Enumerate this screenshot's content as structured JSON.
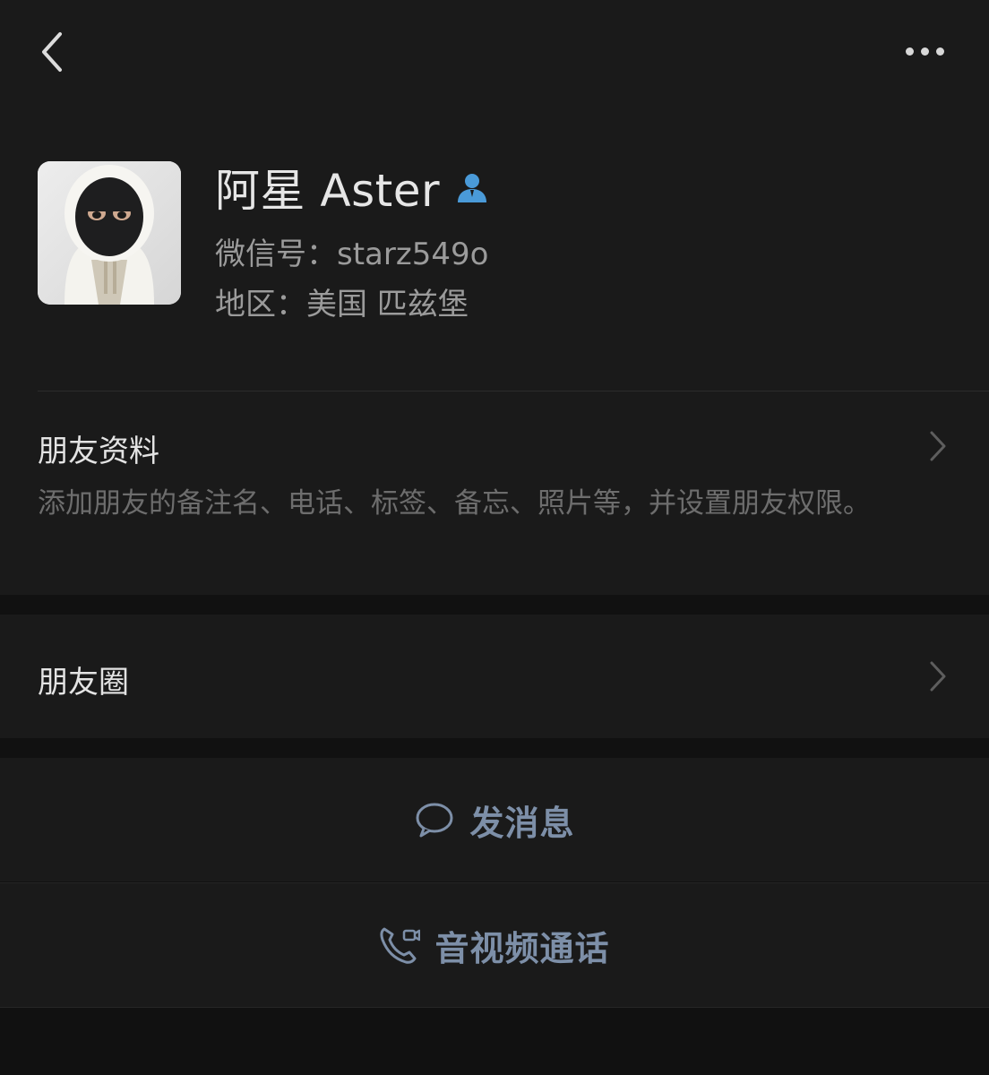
{
  "header": {
    "back_icon": "chevron-left-icon",
    "more_icon": "more-dots-icon"
  },
  "profile": {
    "name": "阿星 Aster",
    "contact_badge_icon": "contact-person-icon",
    "wechat_id_line": "微信号：starz549o",
    "region_line": "地区：美国 匹兹堡",
    "avatar_alt": "avatar"
  },
  "friend_info": {
    "title": "朋友资料",
    "description": "添加朋友的备注名、电话、标签、备忘、照片等，并设置朋友权限。"
  },
  "moments": {
    "title": "朋友圈"
  },
  "actions": {
    "message_label": "发消息",
    "call_label": "音视频通话"
  },
  "colors": {
    "background": "#111111",
    "panel": "#1a1a1a",
    "accent_link": "#7d8fa8",
    "badge_blue": "#4a9ad8"
  }
}
